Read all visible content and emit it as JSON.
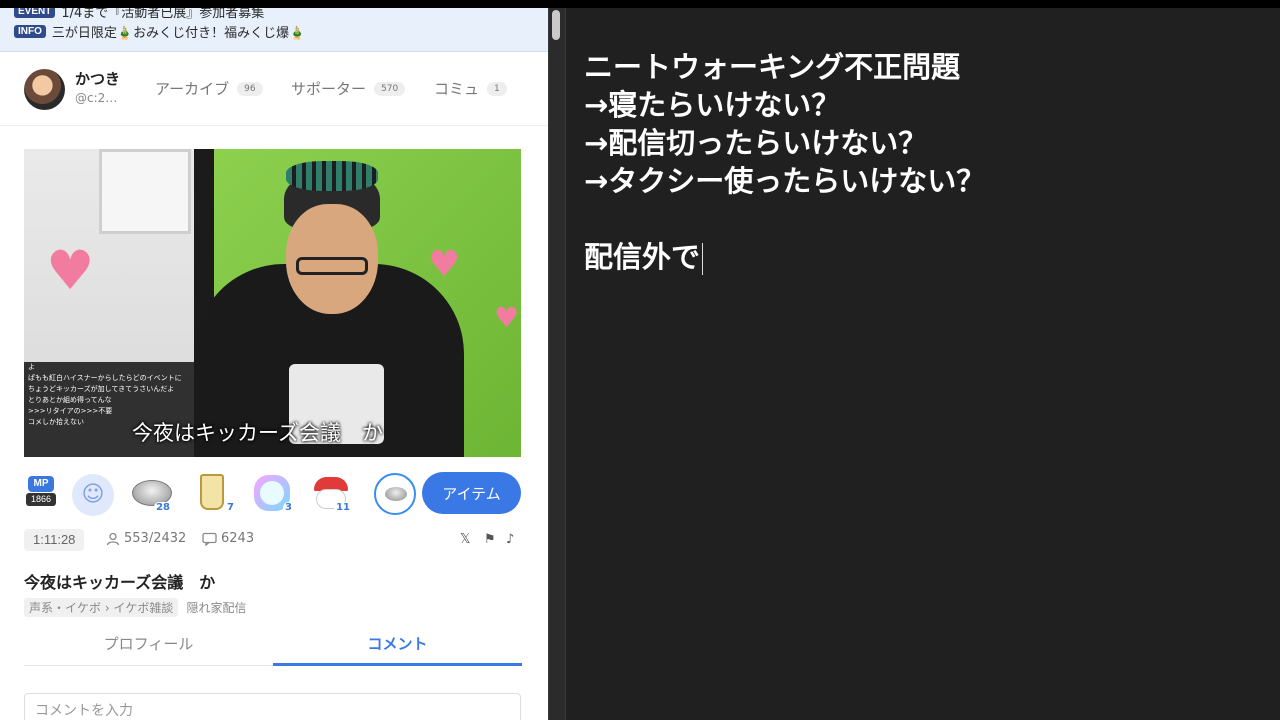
{
  "banner": {
    "event_tag": "EVENT",
    "event_text": "1/4まで『活動者已展』参加者募集",
    "info_tag": "INFO",
    "info_text": "三が日限定🎍おみくじ付き！福みくじ爆🎍"
  },
  "profile": {
    "name": "かつき",
    "handle": "@c:2…",
    "tabs": [
      {
        "label": "アーカイブ",
        "count": "96"
      },
      {
        "label": "サポーター",
        "count": "570"
      },
      {
        "label": "コミュ",
        "count": "1"
      }
    ]
  },
  "video": {
    "caption": "今夜はキッカーズ会議　か",
    "chat_lines": [
      "よ",
      "ぱもも紅白ハイスナーからしたらどのイベントに",
      "ちょうどキッカーズが加してきてうさいんだよ",
      "とりあとか組め得ってんな",
      ">>>リタイアの>>>不要",
      "コメしか拾えない"
    ]
  },
  "items": {
    "mp_label": "MP",
    "mp_value": "1866",
    "counts": [
      "28",
      "7",
      "3",
      "11"
    ],
    "item_button": "アイテム"
  },
  "stats": {
    "duration": "1:11:28",
    "viewers": "553/2432",
    "comments": "6243"
  },
  "stream": {
    "title": "今夜はキッカーズ会議　か",
    "category": "声系・イケボ › イケボ雑談",
    "hidden": "隠れ家配信"
  },
  "tabs": {
    "profile": "プロフィール",
    "comment": "コメント"
  },
  "comment_input": {
    "placeholder": "コメントを入力"
  },
  "note": {
    "lines": [
      "ニートウォーキング不正問題",
      "→寝たらいけない？",
      "→配信切ったらいけない？",
      "→タクシー使ったらいけない？",
      "",
      "配信外で"
    ]
  }
}
